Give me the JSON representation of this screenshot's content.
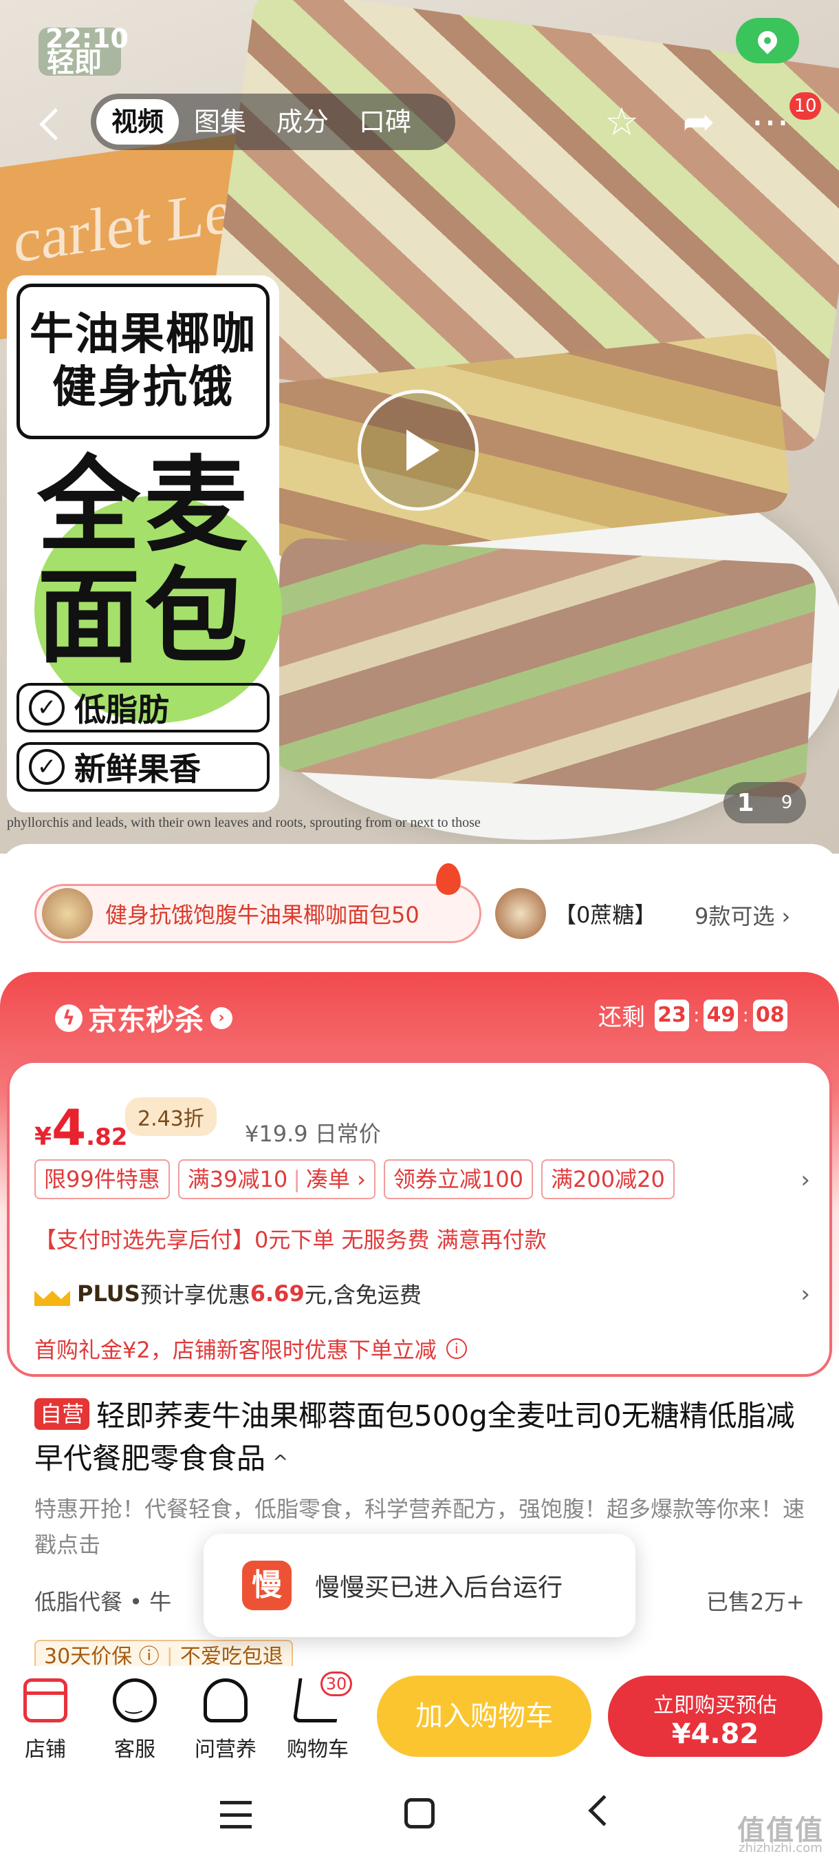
{
  "status_bar": {
    "time": "22:10"
  },
  "brand_logo_text": "轻即",
  "header": {
    "tabs": [
      {
        "label": "视频",
        "active": true
      },
      {
        "label": "图集",
        "active": false
      },
      {
        "label": "成分",
        "active": false
      },
      {
        "label": "口碑",
        "active": false
      }
    ],
    "more_badge": "10",
    "icons": [
      "back-icon",
      "star-icon",
      "share-icon",
      "more-icon",
      "location-icon"
    ]
  },
  "hero": {
    "box_text": "carlet Le",
    "poster": {
      "title_line1": "牛油果椰咖",
      "title_line2": "健身抗饿",
      "big_line1": "全麦",
      "big_line2": "面包",
      "check1": "低脂肪",
      "check2": "新鲜果香"
    },
    "newsprint": "phyllorchis and        leads, with their own leaves and        roots, sprouting from or next to those",
    "page_current": "1",
    "page_total": "9"
  },
  "variants": {
    "selected_label": "健身抗饿饱腹牛油果椰咖面包50",
    "second_label": "【0蔗糖】",
    "count_label": "9款可选 ›"
  },
  "flash_sale": {
    "title": "京东秒杀",
    "remaining_label": "还剩",
    "hours": "23",
    "minutes": "49",
    "seconds": "08",
    "colors": {
      "accent": "#f24a4e",
      "price": "#e8232f"
    }
  },
  "price": {
    "symbol": "¥",
    "integer": "4",
    "decimal": ".82",
    "discount": "2.43折",
    "original": "¥19.9 日常价"
  },
  "promo_tags": [
    {
      "label": "限99件特惠"
    },
    {
      "label": "满39减10",
      "extra": "凑单 ›"
    },
    {
      "label": "领券立减100"
    },
    {
      "label": "满200减20"
    }
  ],
  "promo_chevron": "›",
  "pay_line": "【支付时选先享后付】0元下单 无服务费 满意再付款",
  "plus_line": {
    "plus": "PLUS",
    "prefix": "预计享优惠",
    "amount": "6.69",
    "suffix": "元,含免运费",
    "chevron": "›"
  },
  "new_customer_line": "首购礼金¥2，店铺新客限时优惠下单立减",
  "product": {
    "badge": "自营",
    "title": "轻即荞麦牛油果椰蓉面包500g全麦吐司0无糖精低脂减早代餐肥零食食品",
    "collapse_glyph": "^",
    "description": "特惠开抢！代餐轻食，低脂零食，科学营养配方，强饱腹！超多爆款等你来！速戳点击",
    "tags_line": "低脂代餐  •  牛",
    "sold": "已售2万+",
    "guarantee_1": "30天价保 ⓘ",
    "guarantee_2": "不爱吃包退"
  },
  "toast": {
    "icon_text": "慢",
    "message": "慢慢买已进入后台运行"
  },
  "action_bar": {
    "store": "店铺",
    "service": "客服",
    "nutrition": "问营养",
    "cart": "购物车",
    "cart_count": "30",
    "add_to_cart": "加入购物车",
    "buy_now_line1": "立即购买预估",
    "buy_now_line2": "¥4.82"
  },
  "watermark": {
    "main": "值值值",
    "sub": "zhizhizhi.com"
  }
}
